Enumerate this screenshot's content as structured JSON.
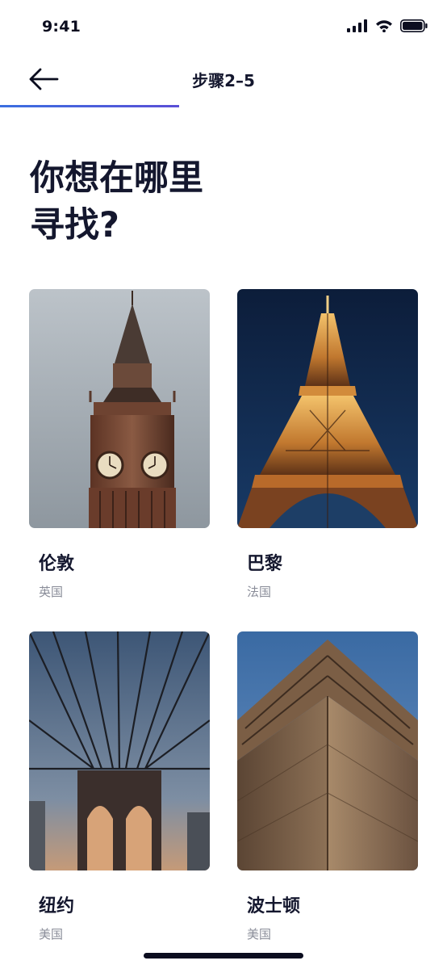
{
  "status_bar": {
    "time": "9:41"
  },
  "header": {
    "step": "步骤2–5",
    "progress_fraction": 0.4
  },
  "title": "你想在哪里\n寻找?",
  "cities": [
    {
      "city": "伦敦",
      "country": "英国",
      "image": "big-ben-photo"
    },
    {
      "city": "巴黎",
      "country": "法国",
      "image": "eiffel-tower-photo"
    },
    {
      "city": "纽约",
      "country": "美国",
      "image": "brooklyn-bridge-photo"
    },
    {
      "city": "波士顿",
      "country": "美国",
      "image": "boston-city-hall-photo"
    }
  ]
}
